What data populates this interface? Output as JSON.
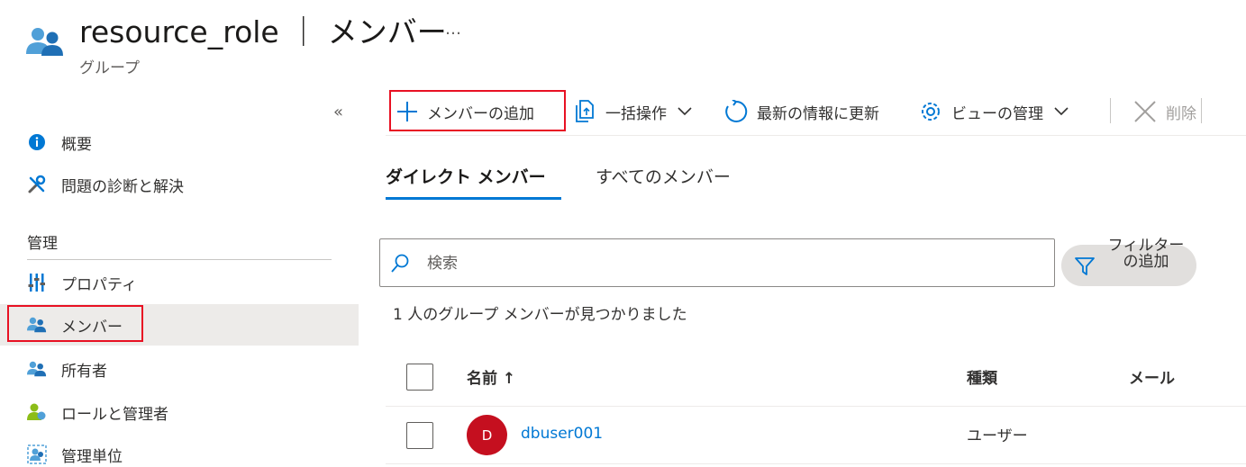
{
  "header": {
    "title": "resource_role ｜ メンバー",
    "more": "…",
    "subtitle": "グループ"
  },
  "sidebar": {
    "collapse": "«",
    "items": [
      {
        "label": "概要",
        "icon": "info-icon"
      },
      {
        "label": "問題の診断と解決",
        "icon": "wrench-icon"
      },
      {
        "label": "プロパティ",
        "icon": "properties-icon"
      },
      {
        "label": "メンバー",
        "icon": "members-icon",
        "selected": true
      },
      {
        "label": "所有者",
        "icon": "owners-icon"
      },
      {
        "label": "ロールと管理者",
        "icon": "roles-icon"
      },
      {
        "label": "管理単位",
        "icon": "admin-units-icon"
      }
    ],
    "section": "管理"
  },
  "toolbar": {
    "add_member": "メンバーの追加",
    "bulk": "一括操作",
    "refresh": "最新の情報に更新",
    "manage_view": "ビューの管理",
    "delete": "削除"
  },
  "tabs": {
    "direct": "ダイレクト メンバー",
    "all": "すべてのメンバー"
  },
  "search": {
    "placeholder": "検索"
  },
  "filter": {
    "label": "フィルターの追加"
  },
  "result_text": "1 人のグループ メンバーが見つかりました",
  "table": {
    "columns": {
      "name": "名前 ↑",
      "type": "種類",
      "mail": "メール"
    },
    "rows": [
      {
        "initial": "D",
        "name": "dbuser001",
        "type": "ユーザー",
        "mail": ""
      }
    ]
  },
  "colors": {
    "accent": "#0078d4",
    "highlight": "#e81123",
    "avatar": "#c50f1f"
  }
}
